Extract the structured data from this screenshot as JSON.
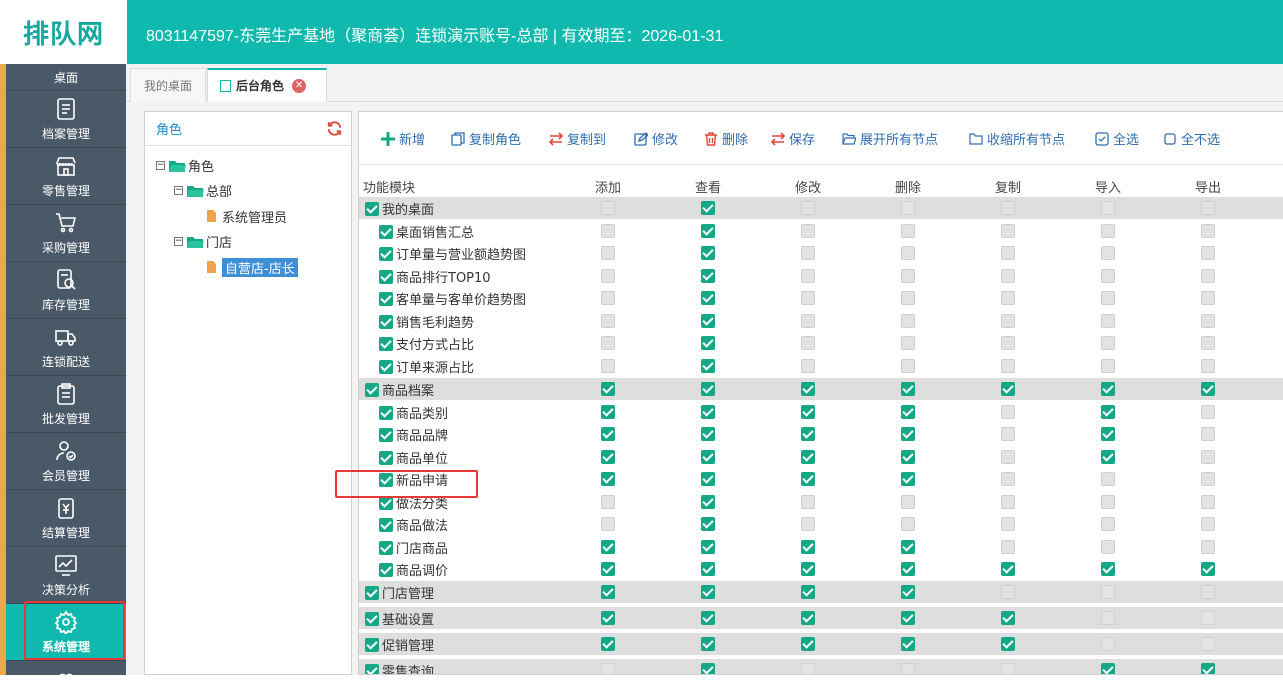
{
  "header": {
    "logo_text": "排队网",
    "title": "8031147597-东莞生产基地（聚商荟）连锁演示账号-总部 | 有效期至：2026-01-31"
  },
  "sidebar": {
    "desk": "桌面",
    "items": [
      {
        "label": "档案管理",
        "icon": "file-cabinet-icon"
      },
      {
        "label": "零售管理",
        "icon": "storefront-icon"
      },
      {
        "label": "采购管理",
        "icon": "cart-icon"
      },
      {
        "label": "库存管理",
        "icon": "inventory-search-icon"
      },
      {
        "label": "连锁配送",
        "icon": "truck-icon"
      },
      {
        "label": "批发管理",
        "icon": "clipboard-icon"
      },
      {
        "label": "会员管理",
        "icon": "member-icon"
      },
      {
        "label": "结算管理",
        "icon": "yen-icon"
      },
      {
        "label": "决策分析",
        "icon": "chart-icon"
      },
      {
        "label": "系统管理",
        "icon": "gear-icon",
        "active": true
      }
    ]
  },
  "tabs": [
    {
      "label": "我的桌面"
    },
    {
      "label": "后台角色"
    }
  ],
  "role_panel": {
    "title": "角色",
    "tree": {
      "root": "角色",
      "hq": "总部",
      "hq_child": "系统管理员",
      "store": "门店",
      "store_child": "自营店-店长"
    }
  },
  "toolbar": {
    "add": "新增",
    "copy_role": "复制角色",
    "copy_to": "复制到",
    "edit": "修改",
    "delete": "删除",
    "save": "保存",
    "expand_all": "展开所有节点",
    "collapse_all": "收缩所有节点",
    "select_all": "全选",
    "select_none": "全不选"
  },
  "grid": {
    "columns": [
      "功能模块",
      "添加",
      "查看",
      "修改",
      "删除",
      "复制",
      "导入",
      "导出"
    ],
    "rows": [
      {
        "name": "我的桌面",
        "group": true,
        "checked": true,
        "perms": [
          0,
          1,
          0,
          0,
          0,
          0,
          0
        ]
      },
      {
        "name": "桌面销售汇总",
        "group": false,
        "checked": true,
        "perms": [
          0,
          1,
          0,
          0,
          0,
          0,
          0
        ]
      },
      {
        "name": "订单量与营业额趋势图",
        "group": false,
        "checked": true,
        "perms": [
          0,
          1,
          0,
          0,
          0,
          0,
          0
        ]
      },
      {
        "name": "商品排行TOP10",
        "group": false,
        "checked": true,
        "perms": [
          0,
          1,
          0,
          0,
          0,
          0,
          0
        ]
      },
      {
        "name": "客单量与客单价趋势图",
        "group": false,
        "checked": true,
        "perms": [
          0,
          1,
          0,
          0,
          0,
          0,
          0
        ]
      },
      {
        "name": "销售毛利趋势",
        "group": false,
        "checked": true,
        "perms": [
          0,
          1,
          0,
          0,
          0,
          0,
          0
        ]
      },
      {
        "name": "支付方式占比",
        "group": false,
        "checked": true,
        "perms": [
          0,
          1,
          0,
          0,
          0,
          0,
          0
        ]
      },
      {
        "name": "订单来源占比",
        "group": false,
        "checked": true,
        "perms": [
          0,
          1,
          0,
          0,
          0,
          0,
          0
        ]
      },
      {
        "name": "商品档案",
        "group": true,
        "checked": true,
        "perms": [
          1,
          1,
          1,
          1,
          1,
          1,
          1
        ]
      },
      {
        "name": "商品类别",
        "group": false,
        "checked": true,
        "perms": [
          1,
          1,
          1,
          1,
          0,
          1,
          0
        ]
      },
      {
        "name": "商品品牌",
        "group": false,
        "checked": true,
        "perms": [
          1,
          1,
          1,
          1,
          0,
          1,
          0
        ]
      },
      {
        "name": "商品单位",
        "group": false,
        "checked": true,
        "perms": [
          1,
          1,
          1,
          1,
          0,
          1,
          0
        ]
      },
      {
        "name": "新品申请",
        "group": false,
        "checked": true,
        "perms": [
          1,
          1,
          1,
          1,
          0,
          0,
          0
        ]
      },
      {
        "name": "做法分类",
        "group": false,
        "checked": true,
        "perms": [
          0,
          1,
          0,
          0,
          0,
          0,
          0
        ]
      },
      {
        "name": "商品做法",
        "group": false,
        "checked": true,
        "perms": [
          0,
          1,
          0,
          0,
          0,
          0,
          0
        ]
      },
      {
        "name": "门店商品",
        "group": false,
        "checked": true,
        "perms": [
          1,
          1,
          1,
          1,
          0,
          0,
          0
        ]
      },
      {
        "name": "商品调价",
        "group": false,
        "checked": true,
        "perms": [
          1,
          1,
          1,
          1,
          1,
          1,
          1
        ]
      },
      {
        "name": "门店管理",
        "group": true,
        "checked": true,
        "perms": [
          1,
          1,
          1,
          1,
          0,
          0,
          0
        ]
      },
      {
        "name": "基础设置",
        "group": true,
        "checked": true,
        "perms": [
          1,
          1,
          1,
          1,
          1,
          0,
          0
        ]
      },
      {
        "name": "促销管理",
        "group": true,
        "checked": true,
        "perms": [
          1,
          1,
          1,
          1,
          1,
          0,
          0
        ]
      },
      {
        "name": "零售查询",
        "group": true,
        "checked": true,
        "perms": [
          0,
          1,
          0,
          0,
          0,
          1,
          1
        ]
      }
    ]
  },
  "colors": {
    "brand": "#0fb9ae",
    "sidebar_bg": "#4a5968",
    "check_on": "#15a886",
    "link": "#2e6db1",
    "highlight": "#e53935"
  }
}
